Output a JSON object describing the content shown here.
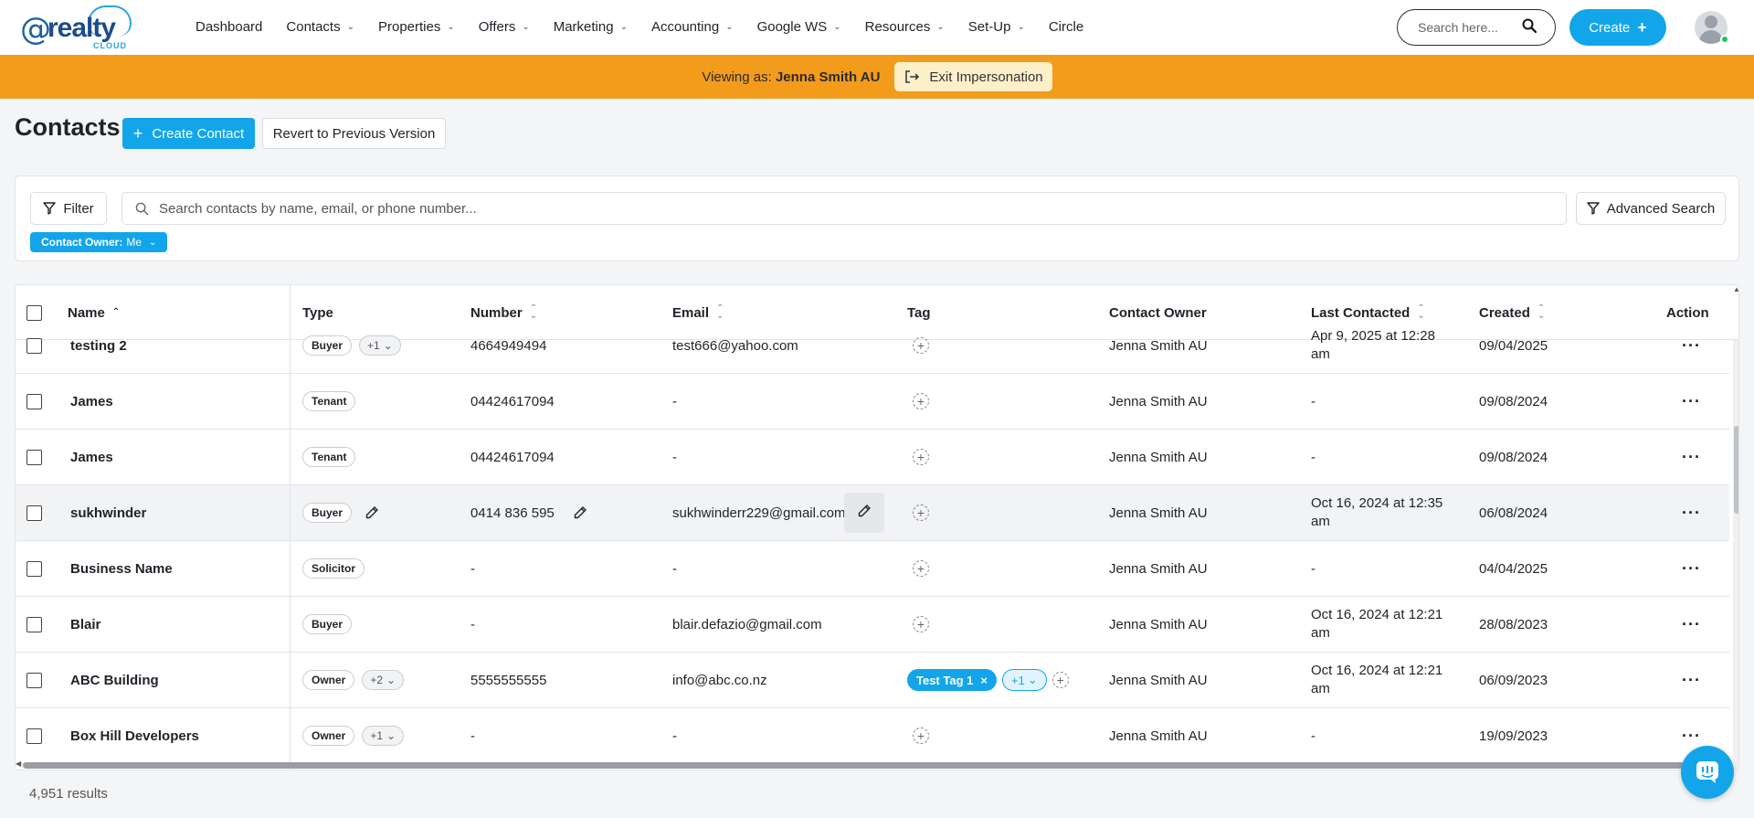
{
  "nav": {
    "logo_at": "@",
    "logo_brand": "realty",
    "logo_sub": "CLOUD",
    "items": [
      {
        "label": "Dashboard",
        "dropdown": false
      },
      {
        "label": "Contacts",
        "dropdown": true
      },
      {
        "label": "Properties",
        "dropdown": true
      },
      {
        "label": "Offers",
        "dropdown": true
      },
      {
        "label": "Marketing",
        "dropdown": true
      },
      {
        "label": "Accounting",
        "dropdown": true
      },
      {
        "label": "Google WS",
        "dropdown": true
      },
      {
        "label": "Resources",
        "dropdown": true
      },
      {
        "label": "Set-Up",
        "dropdown": true
      },
      {
        "label": "Circle",
        "dropdown": false
      }
    ],
    "search_placeholder": "Search here...",
    "create_label": "Create"
  },
  "banner": {
    "prefix": "Viewing as:",
    "user": "Jenna Smith AU",
    "exit_label": "Exit Impersonation"
  },
  "page": {
    "title": "Contacts",
    "create_contact_label": "Create Contact",
    "revert_label": "Revert to Previous Version"
  },
  "filters": {
    "filter_label": "Filter",
    "search_placeholder": "Search contacts by name, email, or phone number...",
    "advanced_label": "Advanced Search",
    "chip_key": "Contact Owner:",
    "chip_value": "Me"
  },
  "table": {
    "columns": {
      "name": "Name",
      "type": "Type",
      "number": "Number",
      "email": "Email",
      "tag": "Tag",
      "owner": "Contact Owner",
      "last": "Last Contacted",
      "created": "Created",
      "action": "Action"
    },
    "rows": [
      {
        "name": "testing 2",
        "type": "Buyer",
        "type_more": "+1",
        "number": "4664949494",
        "email": "test666@yahoo.com",
        "tag": "",
        "tag_more": "",
        "owner": "Jenna Smith AU",
        "last": "Apr 9, 2025 at 12:28 am",
        "created": "09/04/2025"
      },
      {
        "name": "James",
        "type": "Tenant",
        "type_more": "",
        "number": "04424617094",
        "email": "-",
        "tag": "",
        "tag_more": "",
        "owner": "Jenna Smith AU",
        "last": "-",
        "created": "09/08/2024"
      },
      {
        "name": "James",
        "type": "Tenant",
        "type_more": "",
        "number": "04424617094",
        "email": "-",
        "tag": "",
        "tag_more": "",
        "owner": "Jenna Smith AU",
        "last": "-",
        "created": "09/08/2024"
      },
      {
        "name": "sukhwinder",
        "type": "Buyer",
        "type_more": "",
        "number": "0414 836 595",
        "email": "sukhwinderr229@gmail.com",
        "tag": "",
        "tag_more": "",
        "owner": "Jenna Smith AU",
        "last": "Oct 16, 2024 at 12:35 am",
        "created": "06/08/2024"
      },
      {
        "name": "Business Name",
        "type": "Solicitor",
        "type_more": "",
        "number": "-",
        "email": "-",
        "tag": "",
        "tag_more": "",
        "owner": "Jenna Smith AU",
        "last": "-",
        "created": "04/04/2025"
      },
      {
        "name": "Blair",
        "type": "Buyer",
        "type_more": "",
        "number": "-",
        "email": "blair.defazio@gmail.com",
        "tag": "",
        "tag_more": "",
        "owner": "Jenna Smith AU",
        "last": "Oct 16, 2024 at 12:21 am",
        "created": "28/08/2023"
      },
      {
        "name": "ABC Building",
        "type": "Owner",
        "type_more": "+2",
        "number": "5555555555",
        "email": "info@abc.co.nz",
        "tag": "Test Tag 1",
        "tag_more": "+1",
        "owner": "Jenna Smith AU",
        "last": "Oct 16, 2024 at 12:21 am",
        "created": "06/09/2023"
      },
      {
        "name": "Box Hill Developers",
        "type": "Owner",
        "type_more": "+1",
        "number": "-",
        "email": "-",
        "tag": "",
        "tag_more": "",
        "owner": "Jenna Smith AU",
        "last": "-",
        "created": "19/09/2023"
      }
    ]
  },
  "footer": {
    "results": "4,951 results"
  },
  "colors": {
    "accent": "#13a5ea",
    "banner": "#f39c1b",
    "exit_button": "#fdf0c9"
  },
  "icons": [
    "search-icon",
    "plus-icon",
    "exit-icon",
    "filter-icon",
    "chevron-down-icon",
    "sort-icon",
    "pencil-icon",
    "add-tag-icon",
    "more-icon",
    "chat-icon"
  ]
}
